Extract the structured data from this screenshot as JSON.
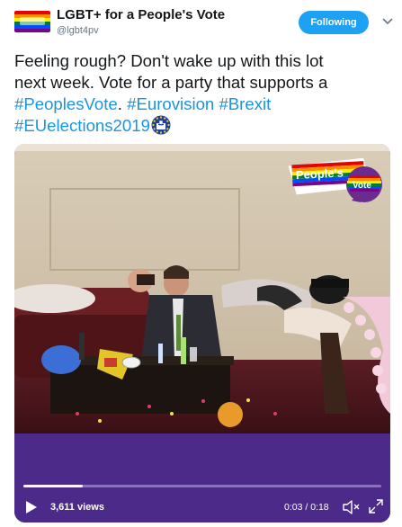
{
  "account": {
    "display_name": "LGBT+ for a People's Vote",
    "handle": "@lgbt4pv",
    "avatar_icon": "rainbow-flag-avatar"
  },
  "follow_button": {
    "label": "Following",
    "color": "#1da1f2"
  },
  "menu_icon": "chevron-down-icon",
  "tweet": {
    "line1": "Feeling rough? Don't wake up with this lot",
    "line2": "next week. Vote for a party that supports a",
    "hashtag1": "#PeoplesVote",
    "sep1": ".  ",
    "hashtag2": "#Eurovision",
    "hashtag3": "#Brexit",
    "hashtag4": "#EUelections2019",
    "emoji": "ballot-box-icon"
  },
  "video": {
    "logo_line1": "People's",
    "logo_line2": "Vote",
    "views": "3,611 views",
    "time": "0:03 / 0:18",
    "progress": 0.167,
    "play_icon": "play-icon",
    "mute_icon": "muted-speaker-icon",
    "fullscreen_icon": "fullscreen-icon"
  },
  "colors": {
    "hashtag": "#1b95e0",
    "video_band": "#4b2a8a",
    "text": "#14171a",
    "muted": "#657786"
  }
}
